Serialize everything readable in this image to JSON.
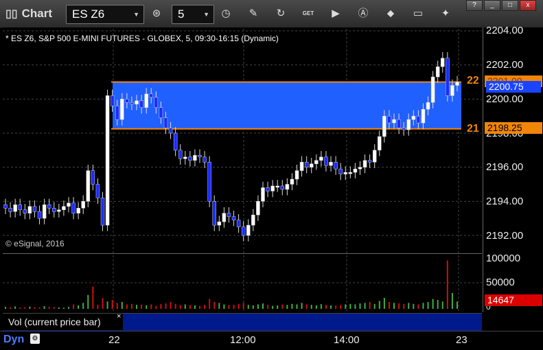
{
  "toolbar": {
    "title": "Chart",
    "symbol": "ES Z6",
    "interval": "5",
    "icons": [
      "zoom-icon",
      "clock-icon",
      "pencil-icon",
      "refresh-icon",
      "get-icon",
      "play-icon",
      "alert-icon",
      "tag-icon",
      "comment-icon",
      "twitter-icon"
    ],
    "get_label": "GET",
    "window_buttons": [
      "?",
      "_",
      "□",
      "x"
    ]
  },
  "chart": {
    "subtitle": "* ES Z6, S&P 500 E-MINI FUTURES - GLOBEX, 5, 09:30-16:15 (Dynamic)",
    "copyright": "© eSignal, 2016",
    "band_color": "#2060ff",
    "level_color": "#f0850a",
    "upper_level_label": "22",
    "lower_level_label": "21",
    "upper_level_price": "2201.00",
    "lower_level_price": "2198.25",
    "last_price": "2200.75",
    "volume_value": "14647",
    "vol_panel_label": "Vol (current price bar)",
    "dyn_label": "Dyn",
    "price_ticks": [
      "2204.00",
      "2202.00",
      "2200.00",
      "2198.00",
      "2196.00",
      "2194.00",
      "2192.00"
    ],
    "volume_ticks": [
      "100000",
      "50000",
      "0"
    ],
    "time_ticks": [
      "22",
      "12:00",
      "14:00",
      "23"
    ]
  },
  "chart_data": {
    "type": "candlestick",
    "yrange": [
      2191.5,
      2204.2
    ],
    "volume_range": [
      0,
      100000
    ],
    "closes": [
      2193.6,
      2193.4,
      2193.8,
      2193.5,
      2193.3,
      2193.7,
      2193.4,
      2193.0,
      2193.8,
      2193.6,
      2193.4,
      2193.5,
      2193.7,
      2193.9,
      2193.3,
      2193.6,
      2194.0,
      2195.8,
      2195.0,
      2194.2,
      2192.6,
      2200.2,
      2199.6,
      2198.8,
      2200.0,
      2199.8,
      2199.7,
      2199.9,
      2199.5,
      2200.3,
      2200.1,
      2199.5,
      2198.9,
      2198.3,
      2198.0,
      2197.0,
      2196.5,
      2196.6,
      2196.4,
      2196.7,
      2196.6,
      2196.3,
      2194.0,
      2192.6,
      2192.8,
      2193.3,
      2193.1,
      2192.9,
      2192.5,
      2192.0,
      2192.6,
      2193.2,
      2194.0,
      2194.8,
      2194.6,
      2194.9,
      2194.9,
      2194.7,
      2195.0,
      2195.3,
      2195.8,
      2196.3,
      2196.0,
      2196.2,
      2196.4,
      2196.6,
      2196.1,
      2196.3,
      2195.9,
      2195.6,
      2195.7,
      2195.7,
      2195.9,
      2196.0,
      2196.4,
      2196.3,
      2197.0,
      2197.8,
      2199.0,
      2198.6,
      2198.8,
      2198.3,
      2198.2,
      2198.8,
      2199.0,
      2198.6,
      2199.4,
      2199.8,
      2201.3,
      2201.9,
      2202.4,
      2200.2,
      2200.8,
      2201.0
    ],
    "volumes": [
      4000,
      3000,
      5000,
      2500,
      3500,
      4500,
      3000,
      2800,
      5500,
      4000,
      3600,
      3000,
      2400,
      3800,
      9000,
      7000,
      12000,
      28000,
      45000,
      8000,
      22000,
      15000,
      18000,
      12000,
      14000,
      9000,
      10000,
      8000,
      8500,
      7000,
      9000,
      6000,
      9500,
      11000,
      14000,
      10000,
      8000,
      9000,
      8000,
      7000,
      6000,
      8000,
      20000,
      14000,
      12000,
      9000,
      7500,
      8000,
      10000,
      12000,
      8000,
      7000,
      9000,
      11000,
      8000,
      6000,
      7000,
      9000,
      8000,
      10000,
      9000,
      12000,
      9000,
      8000,
      7000,
      9500,
      8000,
      7000,
      6500,
      8000,
      9000,
      10000,
      9000,
      11000,
      12000,
      14000,
      10000,
      16000,
      22000,
      14000,
      12000,
      11000,
      10000,
      12000,
      10000,
      9000,
      12000,
      14000,
      20000,
      18000,
      14647,
      98000,
      32000,
      14647
    ]
  }
}
